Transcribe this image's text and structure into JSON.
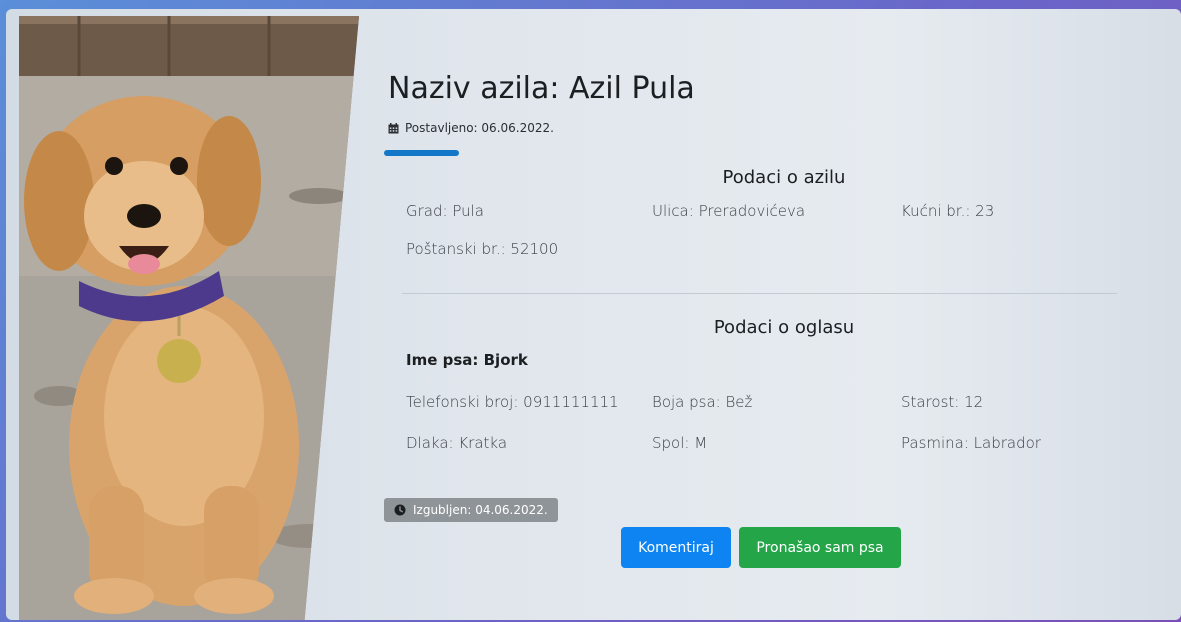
{
  "shelter": {
    "title": "Naziv azila: Azil Pula",
    "posted": "Postavljeno: 06.06.2022."
  },
  "shelter_section": {
    "heading": "Podaci o azilu",
    "city": "Grad: Pula",
    "street": "Ulica: Preradovićeva",
    "house_number": "Kućni br.: 23",
    "postal_code": "Poštanski br.: 52100"
  },
  "ad_section": {
    "heading": "Podaci o oglasu",
    "dog_name": "Ime psa: Bjork",
    "phone": "Telefonski broj: 0911111111",
    "color": "Boja psa: Bež",
    "age": "Starost: 12",
    "fur": "Dlaka: Kratka",
    "sex": "Spol: M",
    "breed": "Pasmina: Labrador"
  },
  "lost_badge": "Izgubljen: 04.06.2022.",
  "buttons": {
    "comment": "Komentiraj",
    "found": "Pronašao sam psa"
  },
  "colors": {
    "accent_bar": "#1478c8",
    "comment_button": "#0d84f2",
    "found_button": "#23a548",
    "badge": "#8f9499"
  },
  "icons": {
    "posted": "calendar-icon",
    "lost": "clock-icon"
  }
}
